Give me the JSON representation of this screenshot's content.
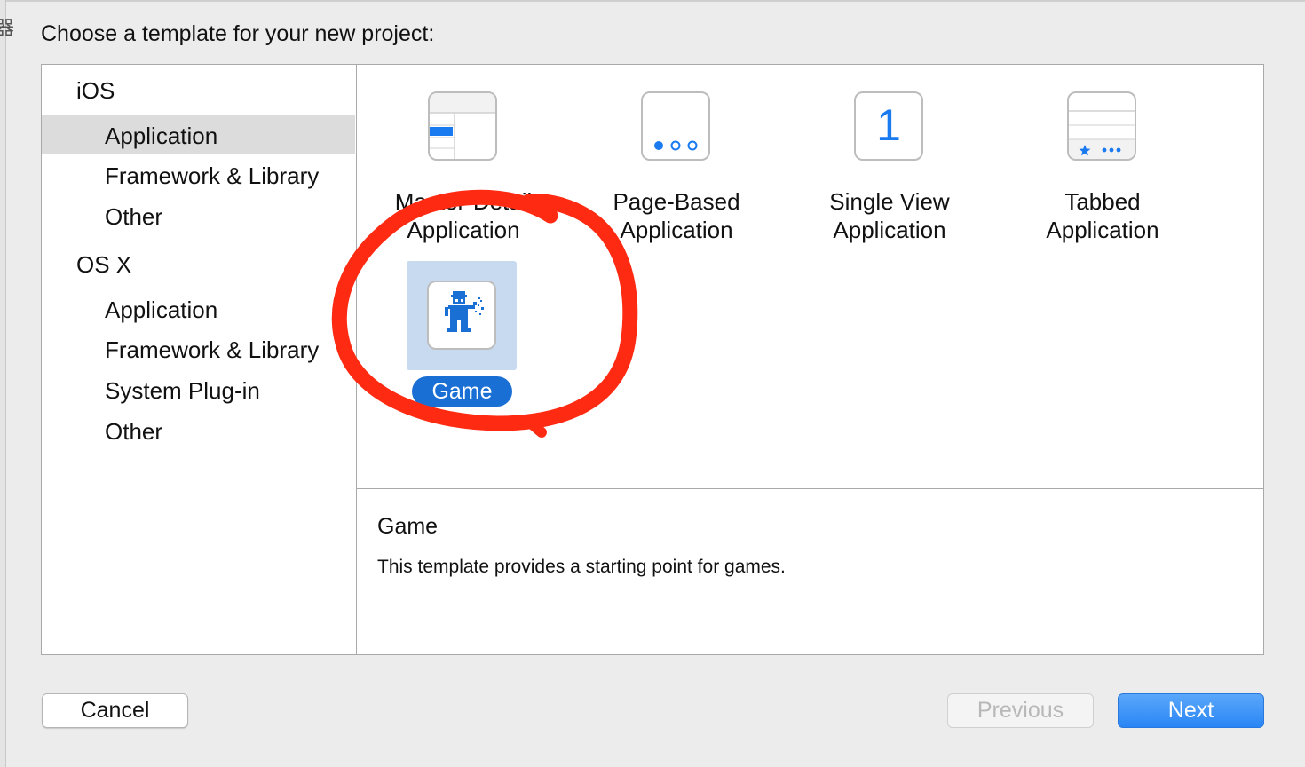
{
  "dialog": {
    "prompt": "Choose a template for your new project:"
  },
  "edge_glyph": "器",
  "sidebar": {
    "groups": [
      {
        "label": "iOS",
        "items": [
          {
            "label": "Application",
            "selected": true
          },
          {
            "label": "Framework & Library",
            "selected": false
          },
          {
            "label": "Other",
            "selected": false
          }
        ]
      },
      {
        "label": "OS X",
        "items": [
          {
            "label": "Application",
            "selected": false
          },
          {
            "label": "Framework & Library",
            "selected": false
          },
          {
            "label": "System Plug-in",
            "selected": false
          },
          {
            "label": "Other",
            "selected": false
          }
        ]
      }
    ]
  },
  "templates": [
    {
      "label": "Master-Detail\nApplication",
      "icon": "master-detail-icon"
    },
    {
      "label": "Page-Based\nApplication",
      "icon": "page-based-icon"
    },
    {
      "label": "Single View\nApplication",
      "icon": "single-view-icon",
      "icon_text": "1"
    },
    {
      "label": "Tabbed\nApplication",
      "icon": "tabbed-icon"
    },
    {
      "label": "Game",
      "icon": "game-icon",
      "selected": true
    }
  ],
  "description": {
    "title": "Game",
    "text": "This template provides a starting point for games."
  },
  "buttons": {
    "cancel": "Cancel",
    "previous": "Previous",
    "next": "Next"
  },
  "colors": {
    "accent": "#1a6fd4",
    "selection_bg": "#c8daf0",
    "annotation": "#ff2a12"
  }
}
